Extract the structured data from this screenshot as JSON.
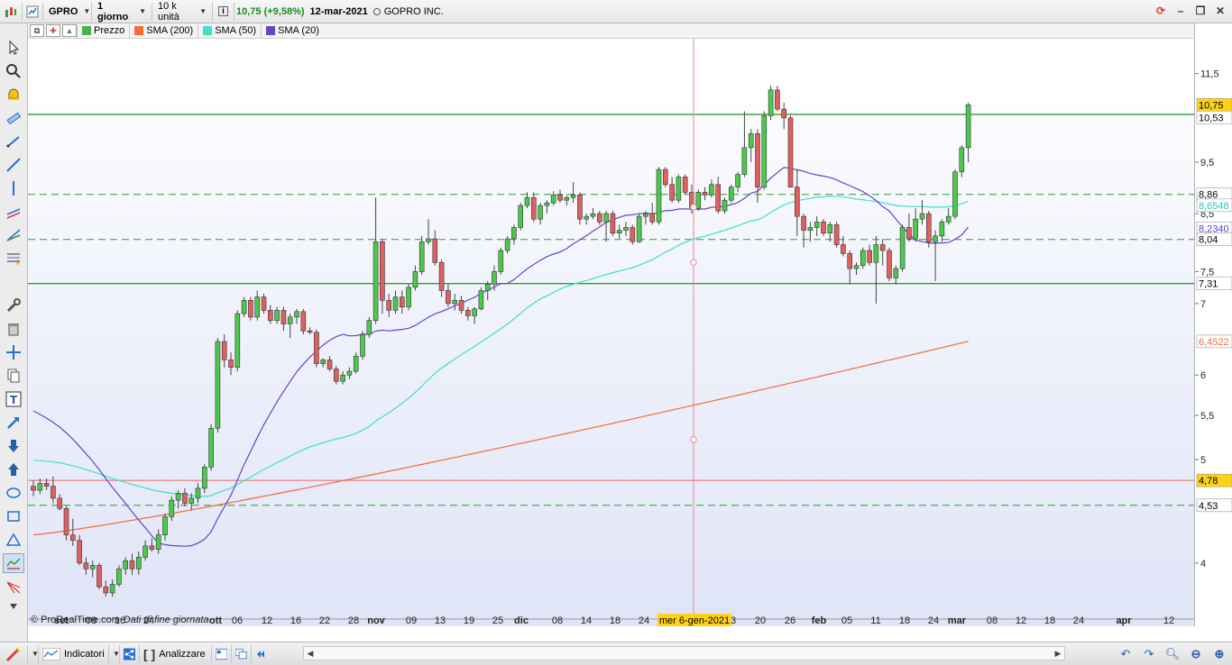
{
  "toolbar": {
    "symbol": "GPRO",
    "timeframe": "1 giorno",
    "units": "10 k unità",
    "info_icon": "info-icon",
    "price_change": "10,75 (+9,58%)",
    "date": "12-mar-2021",
    "instrument_name": "GOPRO INC."
  },
  "legend": {
    "items": [
      {
        "label": "Prezzo",
        "color": "#4caf50"
      },
      {
        "label": "SMA (200)",
        "color": "#f26b3a"
      },
      {
        "label": "SMA (50)",
        "color": "#3ee0c8"
      },
      {
        "label": "SMA (20)",
        "color": "#6a42c8"
      }
    ]
  },
  "price_axis": {
    "ticks": [
      "11,5",
      "9,5",
      "8,5",
      "7,5",
      "7",
      "6",
      "5,5",
      "5",
      "4"
    ],
    "labels": [
      {
        "text": "10,75",
        "bg": "#ffd21a",
        "fg": "#000000"
      },
      {
        "text": "10,53",
        "bg": "#ffffff",
        "fg": "#000000"
      },
      {
        "text": "8,86",
        "bg": "#ffffff",
        "fg": "#000000"
      },
      {
        "text": "8,6548",
        "bg": "#ffffff",
        "fg": "#2bc9b0"
      },
      {
        "text": "8,2340",
        "bg": "#ffffff",
        "fg": "#5b3cc4"
      },
      {
        "text": "8,04",
        "bg": "#ffffff",
        "fg": "#000000"
      },
      {
        "text": "7,31",
        "bg": "#ffffff",
        "fg": "#000000"
      },
      {
        "text": "6,4522",
        "bg": "#ffffff",
        "fg": "#f26b3a"
      },
      {
        "text": "4,78",
        "bg": "#ffd21a",
        "fg": "#000000"
      },
      {
        "text": "4,53",
        "bg": "#ffffff",
        "fg": "#000000"
      }
    ]
  },
  "time_axis": {
    "labels": [
      "set",
      "08",
      "16",
      "24",
      "ott",
      "06",
      "12",
      "16",
      "22",
      "28",
      "nov",
      "09",
      "13",
      "19",
      "25",
      "dic",
      "08",
      "14",
      "18",
      "24",
      "3",
      "20",
      "26",
      "feb",
      "05",
      "11",
      "18",
      "24",
      "mar",
      "08",
      "12",
      "18",
      "24",
      "apr",
      "12"
    ],
    "crosshair_label": "mer 6-gen-2021"
  },
  "copyright": {
    "text": "© ProRealTime.com",
    "note": "Dati di fine giornata"
  },
  "bottombar": {
    "indicators_label": "Indicatori",
    "analyze_label": "Analizzare"
  },
  "chart_data": {
    "type": "candlestick",
    "title": "",
    "ylim": [
      3.6,
      12.3
    ],
    "y_scale": "log",
    "grid": false,
    "legend_position": "top-left",
    "series": [
      {
        "name": "Prezzo",
        "kind": "candles"
      },
      {
        "name": "SMA (200)",
        "last": 6.4522
      },
      {
        "name": "SMA (50)",
        "last": 8.6548
      },
      {
        "name": "SMA (20)",
        "last": 8.234
      }
    ],
    "horizontal_levels": [
      {
        "value": 10.53,
        "style": "solid",
        "color": "#2e9e2e"
      },
      {
        "value": 8.86,
        "style": "dashed",
        "color": "#2e9e2e"
      },
      {
        "value": 8.04,
        "style": "dashed",
        "color": "#2e9e2e"
      },
      {
        "value": 7.31,
        "style": "solid",
        "color": "#2e9e2e"
      },
      {
        "value": 4.78,
        "style": "solid",
        "color": "#e88a8a"
      },
      {
        "value": 4.53,
        "style": "dashed",
        "color": "#2e9e2e"
      }
    ],
    "last_close": 10.75,
    "crosshair_date": "mer 6-gen-2021",
    "candles": [
      [
        4.72,
        4.78,
        4.62,
        4.68
      ],
      [
        4.68,
        4.8,
        4.64,
        4.75
      ],
      [
        4.75,
        4.8,
        4.68,
        4.72
      ],
      [
        4.72,
        4.82,
        4.55,
        4.6
      ],
      [
        4.6,
        4.64,
        4.48,
        4.5
      ],
      [
        4.5,
        4.52,
        4.2,
        4.25
      ],
      [
        4.25,
        4.4,
        4.15,
        4.2
      ],
      [
        4.2,
        4.25,
        3.98,
        4.0
      ],
      [
        4.0,
        4.05,
        3.9,
        3.95
      ],
      [
        3.95,
        4.02,
        3.88,
        3.98
      ],
      [
        3.98,
        4.0,
        3.78,
        3.8
      ],
      [
        3.8,
        3.85,
        3.72,
        3.75
      ],
      [
        3.75,
        3.86,
        3.72,
        3.82
      ],
      [
        3.82,
        3.98,
        3.8,
        3.95
      ],
      [
        3.95,
        4.05,
        3.9,
        4.02
      ],
      [
        4.02,
        4.08,
        3.9,
        3.95
      ],
      [
        3.95,
        4.1,
        3.9,
        4.05
      ],
      [
        4.05,
        4.2,
        4.02,
        4.15
      ],
      [
        4.15,
        4.22,
        4.1,
        4.12
      ],
      [
        4.12,
        4.3,
        4.08,
        4.25
      ],
      [
        4.25,
        4.45,
        4.2,
        4.42
      ],
      [
        4.42,
        4.62,
        4.38,
        4.58
      ],
      [
        4.58,
        4.68,
        4.5,
        4.65
      ],
      [
        4.65,
        4.7,
        4.52,
        4.55
      ],
      [
        4.55,
        4.65,
        4.48,
        4.6
      ],
      [
        4.6,
        4.75,
        4.55,
        4.7
      ],
      [
        4.7,
        4.95,
        4.65,
        4.92
      ],
      [
        4.92,
        5.4,
        4.88,
        5.35
      ],
      [
        5.35,
        6.5,
        5.3,
        6.45
      ],
      [
        6.45,
        6.55,
        6.1,
        6.2
      ],
      [
        6.2,
        6.3,
        6.0,
        6.1
      ],
      [
        6.1,
        6.9,
        6.05,
        6.85
      ],
      [
        6.85,
        7.1,
        6.8,
        7.05
      ],
      [
        7.05,
        7.1,
        6.75,
        6.8
      ],
      [
        6.8,
        7.2,
        6.75,
        7.1
      ],
      [
        7.1,
        7.15,
        6.85,
        6.9
      ],
      [
        6.9,
        6.98,
        6.7,
        6.75
      ],
      [
        6.75,
        6.95,
        6.7,
        6.9
      ],
      [
        6.9,
        6.95,
        6.6,
        6.7
      ],
      [
        6.7,
        6.85,
        6.5,
        6.8
      ],
      [
        6.8,
        6.92,
        6.7,
        6.88
      ],
      [
        6.88,
        6.92,
        6.55,
        6.6
      ],
      [
        6.6,
        6.65,
        6.55,
        6.58
      ],
      [
        6.58,
        6.62,
        6.1,
        6.15
      ],
      [
        6.15,
        6.22,
        6.1,
        6.2
      ],
      [
        6.2,
        6.25,
        6.05,
        6.08
      ],
      [
        6.08,
        6.12,
        5.88,
        5.92
      ],
      [
        5.92,
        6.05,
        5.88,
        6.0
      ],
      [
        6.0,
        6.1,
        5.95,
        6.05
      ],
      [
        6.05,
        6.3,
        6.02,
        6.25
      ],
      [
        6.25,
        6.6,
        6.2,
        6.55
      ],
      [
        6.55,
        6.8,
        6.5,
        6.75
      ],
      [
        6.75,
        8.8,
        6.7,
        8.0
      ],
      [
        8.0,
        8.05,
        6.85,
        7.05
      ],
      [
        7.05,
        7.15,
        6.8,
        6.9
      ],
      [
        6.9,
        7.2,
        6.85,
        7.1
      ],
      [
        7.1,
        7.2,
        6.85,
        6.95
      ],
      [
        6.95,
        7.3,
        6.9,
        7.25
      ],
      [
        7.25,
        7.6,
        7.2,
        7.5
      ],
      [
        7.5,
        8.1,
        7.45,
        8.0
      ],
      [
        8.0,
        8.4,
        7.95,
        8.05
      ],
      [
        8.05,
        8.2,
        7.6,
        7.65
      ],
      [
        7.65,
        7.7,
        7.1,
        7.2
      ],
      [
        7.2,
        7.3,
        6.95,
        7.0
      ],
      [
        7.0,
        7.15,
        6.9,
        7.05
      ],
      [
        7.05,
        7.12,
        6.85,
        6.9
      ],
      [
        6.9,
        6.95,
        6.75,
        6.82
      ],
      [
        6.82,
        6.95,
        6.7,
        6.92
      ],
      [
        6.92,
        7.25,
        6.9,
        7.2
      ],
      [
        7.2,
        7.35,
        7.05,
        7.3
      ],
      [
        7.3,
        7.6,
        7.2,
        7.5
      ],
      [
        7.5,
        7.9,
        7.45,
        7.85
      ],
      [
        7.85,
        8.1,
        7.8,
        8.05
      ],
      [
        8.05,
        8.3,
        7.95,
        8.25
      ],
      [
        8.25,
        8.7,
        8.2,
        8.65
      ],
      [
        8.65,
        8.9,
        8.6,
        8.8
      ],
      [
        8.8,
        8.9,
        8.35,
        8.4
      ],
      [
        8.4,
        8.7,
        8.3,
        8.65
      ],
      [
        8.65,
        8.75,
        8.5,
        8.7
      ],
      [
        8.7,
        8.92,
        8.65,
        8.85
      ],
      [
        8.85,
        8.95,
        8.7,
        8.75
      ],
      [
        8.75,
        8.85,
        8.65,
        8.8
      ],
      [
        8.8,
        9.1,
        8.7,
        8.85
      ],
      [
        8.85,
        8.9,
        8.3,
        8.4
      ],
      [
        8.4,
        8.5,
        8.3,
        8.45
      ],
      [
        8.45,
        8.6,
        8.4,
        8.5
      ],
      [
        8.5,
        8.55,
        8.3,
        8.35
      ],
      [
        8.35,
        8.55,
        8.0,
        8.5
      ],
      [
        8.5,
        8.55,
        8.1,
        8.15
      ],
      [
        8.15,
        8.3,
        8.05,
        8.2
      ],
      [
        8.2,
        8.35,
        8.1,
        8.25
      ],
      [
        8.25,
        8.3,
        7.95,
        8.0
      ],
      [
        8.0,
        8.5,
        7.98,
        8.45
      ],
      [
        8.45,
        8.55,
        8.3,
        8.5
      ],
      [
        8.5,
        8.7,
        8.3,
        8.35
      ],
      [
        8.35,
        9.4,
        8.3,
        9.35
      ],
      [
        9.35,
        9.4,
        9.0,
        9.05
      ],
      [
        9.05,
        9.2,
        8.7,
        8.75
      ],
      [
        8.75,
        9.25,
        8.7,
        9.2
      ],
      [
        9.2,
        9.25,
        8.85,
        8.9
      ],
      [
        8.9,
        9.05,
        8.5,
        8.6
      ],
      [
        8.6,
        8.95,
        8.55,
        8.9
      ],
      [
        8.9,
        9.0,
        8.75,
        8.85
      ],
      [
        8.85,
        9.15,
        8.8,
        9.05
      ],
      [
        9.05,
        9.2,
        8.5,
        8.55
      ],
      [
        8.55,
        8.8,
        8.5,
        8.75
      ],
      [
        8.75,
        9.05,
        8.7,
        9.0
      ],
      [
        9.0,
        9.3,
        8.9,
        9.25
      ],
      [
        9.25,
        10.6,
        9.2,
        9.8
      ],
      [
        9.8,
        10.2,
        9.5,
        10.1
      ],
      [
        10.1,
        10.2,
        8.7,
        9.0
      ],
      [
        9.0,
        10.6,
        8.95,
        10.5
      ],
      [
        10.5,
        11.2,
        10.4,
        11.1
      ],
      [
        11.1,
        11.2,
        10.6,
        10.65
      ],
      [
        10.65,
        10.8,
        10.2,
        10.45
      ],
      [
        10.45,
        10.5,
        9.6,
        9.0
      ],
      [
        9.0,
        9.35,
        8.1,
        8.45
      ],
      [
        8.45,
        8.5,
        7.9,
        8.2
      ],
      [
        8.2,
        8.35,
        8.0,
        8.25
      ],
      [
        8.25,
        8.45,
        8.1,
        8.35
      ],
      [
        8.35,
        8.4,
        8.1,
        8.15
      ],
      [
        8.15,
        8.35,
        8.0,
        8.3
      ],
      [
        8.3,
        8.35,
        7.9,
        7.95
      ],
      [
        7.95,
        8.1,
        7.75,
        7.8
      ],
      [
        7.8,
        7.85,
        7.3,
        7.55
      ],
      [
        7.55,
        7.65,
        7.45,
        7.6
      ],
      [
        7.6,
        7.9,
        7.55,
        7.85
      ],
      [
        7.85,
        7.95,
        7.6,
        7.65
      ],
      [
        7.65,
        8.1,
        7.0,
        7.95
      ],
      [
        7.95,
        8.05,
        7.6,
        7.85
      ],
      [
        7.85,
        7.9,
        7.35,
        7.4
      ],
      [
        7.4,
        7.6,
        7.3,
        7.55
      ],
      [
        7.55,
        8.3,
        7.5,
        8.25
      ],
      [
        8.25,
        8.5,
        8.0,
        8.05
      ],
      [
        8.05,
        8.6,
        8.0,
        8.4
      ],
      [
        8.4,
        8.75,
        8.3,
        8.5
      ],
      [
        8.5,
        8.55,
        7.9,
        8.0
      ],
      [
        8.0,
        8.2,
        7.35,
        8.1
      ],
      [
        8.1,
        8.4,
        8.0,
        8.35
      ],
      [
        8.35,
        8.6,
        8.3,
        8.45
      ],
      [
        8.45,
        9.35,
        8.4,
        9.3
      ],
      [
        9.3,
        9.85,
        9.2,
        9.8
      ],
      [
        9.8,
        10.8,
        9.5,
        10.75
      ]
    ]
  }
}
